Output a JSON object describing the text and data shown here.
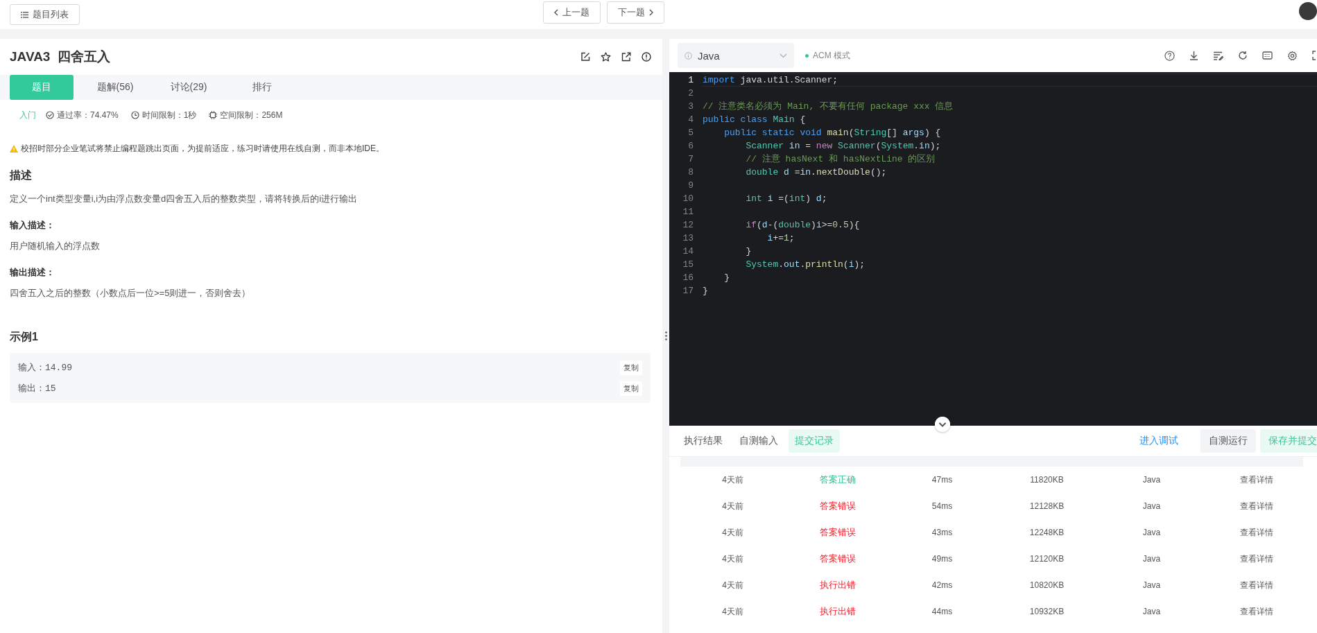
{
  "top_bar": {
    "list_button": "题目列表",
    "prev_button": "上一题",
    "next_button": "下一题"
  },
  "problem": {
    "title": "JAVA3  四舍五入",
    "tabs": [
      {
        "label": "题目",
        "selected": true
      },
      {
        "label": "题解(56)",
        "selected": false
      },
      {
        "label": "讨论(29)",
        "selected": false
      },
      {
        "label": "排行",
        "selected": false
      }
    ],
    "difficulty": "入门",
    "pass_rate": "通过率：74.47%",
    "time_limit": "时间限制：1秒",
    "memory_limit": "空间限制：256M",
    "warning": "校招时部分企业笔试将禁止编程题跳出页面，为提前适应，练习时请使用在线自测，而非本地IDE。",
    "sections": [
      {
        "kind": "heading",
        "text": "描述"
      },
      {
        "kind": "text",
        "text": "定义一个int类型变量i,i为由浮点数变量d四舍五入后的整数类型，请将转换后的i进行输出"
      },
      {
        "kind": "subheading",
        "text": "输入描述："
      },
      {
        "kind": "text",
        "text": "用户随机输入的浮点数"
      },
      {
        "kind": "subheading",
        "text": "输出描述："
      },
      {
        "kind": "text",
        "text": "四舍五入之后的整数（小数点后一位>=5则进一，否则舍去）"
      }
    ],
    "example": {
      "title": "示例1",
      "rows": [
        {
          "text": "输入：14.99",
          "copy": "复制"
        },
        {
          "text": "输出：15",
          "copy": "复制"
        }
      ]
    }
  },
  "editor": {
    "language": "Java",
    "mode": "ACM 模式",
    "lines": [
      {
        "number": "1",
        "current": true,
        "tokens": [
          {
            "kind": "keyword",
            "text": "import"
          },
          {
            "kind": "plain",
            "text": " java.util.Scanner;"
          }
        ]
      },
      {
        "number": "2",
        "current": false
      },
      {
        "number": "3",
        "current": false,
        "tokens": [
          {
            "kind": "comment",
            "text": "// 注意类名必须为 Main, 不要有任何 package xxx 信息"
          }
        ]
      },
      {
        "number": "4",
        "current": false,
        "tokens": [
          {
            "kind": "keyword",
            "text": "public "
          },
          {
            "kind": "keyword",
            "text": "class "
          },
          {
            "kind": "type",
            "text": "Main"
          },
          {
            "kind": "plain",
            "text": " {"
          }
        ]
      },
      {
        "number": "5",
        "current": false,
        "tokens": [
          {
            "kind": "keyword",
            "text": "    public "
          },
          {
            "kind": "keyword",
            "text": "static "
          },
          {
            "kind": "keyword",
            "text": "void "
          },
          {
            "kind": "function",
            "text": "main"
          },
          {
            "kind": "plain",
            "text": "("
          },
          {
            "kind": "type",
            "text": "String"
          },
          {
            "kind": "plain",
            "text": "[] "
          },
          {
            "kind": "variable",
            "text": "args"
          },
          {
            "kind": "plain",
            "text": ") {"
          }
        ]
      },
      {
        "number": "6",
        "current": false,
        "tokens": [
          {
            "kind": "type",
            "text": "        Scanner "
          },
          {
            "kind": "variable",
            "text": "in"
          },
          {
            "kind": "plain",
            "text": " = "
          },
          {
            "kind": "control",
            "text": "new "
          },
          {
            "kind": "type",
            "text": "Scanner"
          },
          {
            "kind": "plain",
            "text": "("
          },
          {
            "kind": "type",
            "text": "System"
          },
          {
            "kind": "plain",
            "text": "."
          },
          {
            "kind": "variable",
            "text": "in"
          },
          {
            "kind": "plain",
            "text": ");"
          }
        ]
      },
      {
        "number": "7",
        "current": false,
        "tokens": [
          {
            "kind": "comment",
            "text": "        // 注意 hasNext 和 hasNextLine 的区别"
          }
        ]
      },
      {
        "number": "8",
        "current": false,
        "tokens": [
          {
            "kind": "type",
            "text": "        double "
          },
          {
            "kind": "variable",
            "text": "d"
          },
          {
            "kind": "plain",
            "text": " ="
          },
          {
            "kind": "variable",
            "text": "in"
          },
          {
            "kind": "plain",
            "text": "."
          },
          {
            "kind": "function",
            "text": "nextDouble"
          },
          {
            "kind": "plain",
            "text": "();"
          }
        ]
      },
      {
        "number": "9",
        "current": false
      },
      {
        "number": "10",
        "current": false,
        "tokens": [
          {
            "kind": "type",
            "text": "        int "
          },
          {
            "kind": "variable",
            "text": "i"
          },
          {
            "kind": "plain",
            "text": " =("
          },
          {
            "kind": "type",
            "text": "int"
          },
          {
            "kind": "plain",
            "text": ") "
          },
          {
            "kind": "variable",
            "text": "d"
          },
          {
            "kind": "plain",
            "text": ";"
          }
        ]
      },
      {
        "number": "11",
        "current": false
      },
      {
        "number": "12",
        "current": false,
        "tokens": [
          {
            "kind": "control",
            "text": "        if"
          },
          {
            "kind": "plain",
            "text": "("
          },
          {
            "kind": "variable",
            "text": "d"
          },
          {
            "kind": "plain",
            "text": "-("
          },
          {
            "kind": "type",
            "text": "double"
          },
          {
            "kind": "plain",
            "text": ")"
          },
          {
            "kind": "variable",
            "text": "i"
          },
          {
            "kind": "plain",
            "text": ">="
          },
          {
            "kind": "number",
            "text": "0.5"
          },
          {
            "kind": "plain",
            "text": "){"
          }
        ]
      },
      {
        "number": "13",
        "current": false,
        "tokens": [
          {
            "kind": "variable",
            "text": "            i"
          },
          {
            "kind": "plain",
            "text": "+="
          },
          {
            "kind": "number",
            "text": "1"
          },
          {
            "kind": "plain",
            "text": ";"
          }
        ]
      },
      {
        "number": "14",
        "current": false,
        "tokens": [
          {
            "kind": "plain",
            "text": "        }"
          }
        ]
      },
      {
        "number": "15",
        "current": false,
        "tokens": [
          {
            "kind": "type",
            "text": "        System"
          },
          {
            "kind": "plain",
            "text": "."
          },
          {
            "kind": "variable",
            "text": "out"
          },
          {
            "kind": "plain",
            "text": "."
          },
          {
            "kind": "function",
            "text": "println"
          },
          {
            "kind": "plain",
            "text": "("
          },
          {
            "kind": "variable",
            "text": "i"
          },
          {
            "kind": "plain",
            "text": ");"
          }
        ]
      },
      {
        "number": "16",
        "current": false,
        "tokens": [
          {
            "kind": "plain",
            "text": "    }"
          }
        ]
      },
      {
        "number": "17",
        "current": false,
        "tokens": [
          {
            "kind": "plain",
            "text": "}"
          }
        ]
      }
    ]
  },
  "console": {
    "tabs": [
      {
        "label": "执行结果",
        "selected": false
      },
      {
        "label": "自测输入",
        "selected": false
      },
      {
        "label": "提交记录",
        "selected": true
      }
    ],
    "debug_link": "进入调试",
    "run_button": "自测运行",
    "submit_button": "保存并提交",
    "submissions": [
      {
        "time": "4天前",
        "status": "答案正确",
        "color": "#2fbf8a",
        "runtime": "47ms",
        "memory": "11820KB",
        "language": "Java",
        "details": "查看详情"
      },
      {
        "time": "4天前",
        "status": "答案错误",
        "color": "#f5222d",
        "runtime": "54ms",
        "memory": "12128KB",
        "language": "Java",
        "details": "查看详情"
      },
      {
        "time": "4天前",
        "status": "答案错误",
        "color": "#f5222d",
        "runtime": "43ms",
        "memory": "12248KB",
        "language": "Java",
        "details": "查看详情"
      },
      {
        "time": "4天前",
        "status": "答案错误",
        "color": "#f5222d",
        "runtime": "49ms",
        "memory": "12120KB",
        "language": "Java",
        "details": "查看详情"
      },
      {
        "time": "4天前",
        "status": "执行出错",
        "color": "#f5222d",
        "runtime": "42ms",
        "memory": "10820KB",
        "language": "Java",
        "details": "查看详情"
      },
      {
        "time": "4天前",
        "status": "执行出错",
        "color": "#f5222d",
        "runtime": "44ms",
        "memory": "10932KB",
        "language": "Java",
        "details": "查看详情"
      }
    ]
  }
}
